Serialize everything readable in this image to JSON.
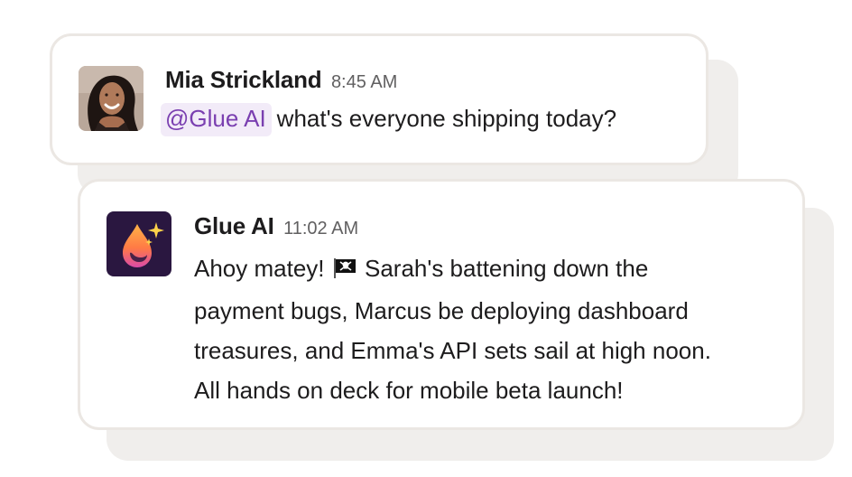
{
  "messages": [
    {
      "author": "Mia Strickland",
      "time": "8:45 AM",
      "mention": "@Glue AI",
      "text": "what's everyone shipping today?"
    },
    {
      "author": "Glue AI",
      "time": "11:02 AM",
      "text_lines": [
        "Ahoy matey!",
        "Sarah's battening down the",
        "payment bugs, Marcus be deploying dashboard",
        "treasures, and Emma's API sets sail at high noon.",
        "All hands on deck for mobile beta launch!"
      ],
      "emoji": "pirate-flag-icon"
    }
  ],
  "colors": {
    "card_border": "#ebe7e3",
    "shadow": "#f0eeec",
    "mention_bg": "#f2ebf8",
    "mention_text": "#7a3fb0",
    "glue_icon_bg": "#2a1740",
    "glue_icon_gradient_top": "#ff9a3c",
    "glue_icon_gradient_bottom": "#d94aa8"
  }
}
